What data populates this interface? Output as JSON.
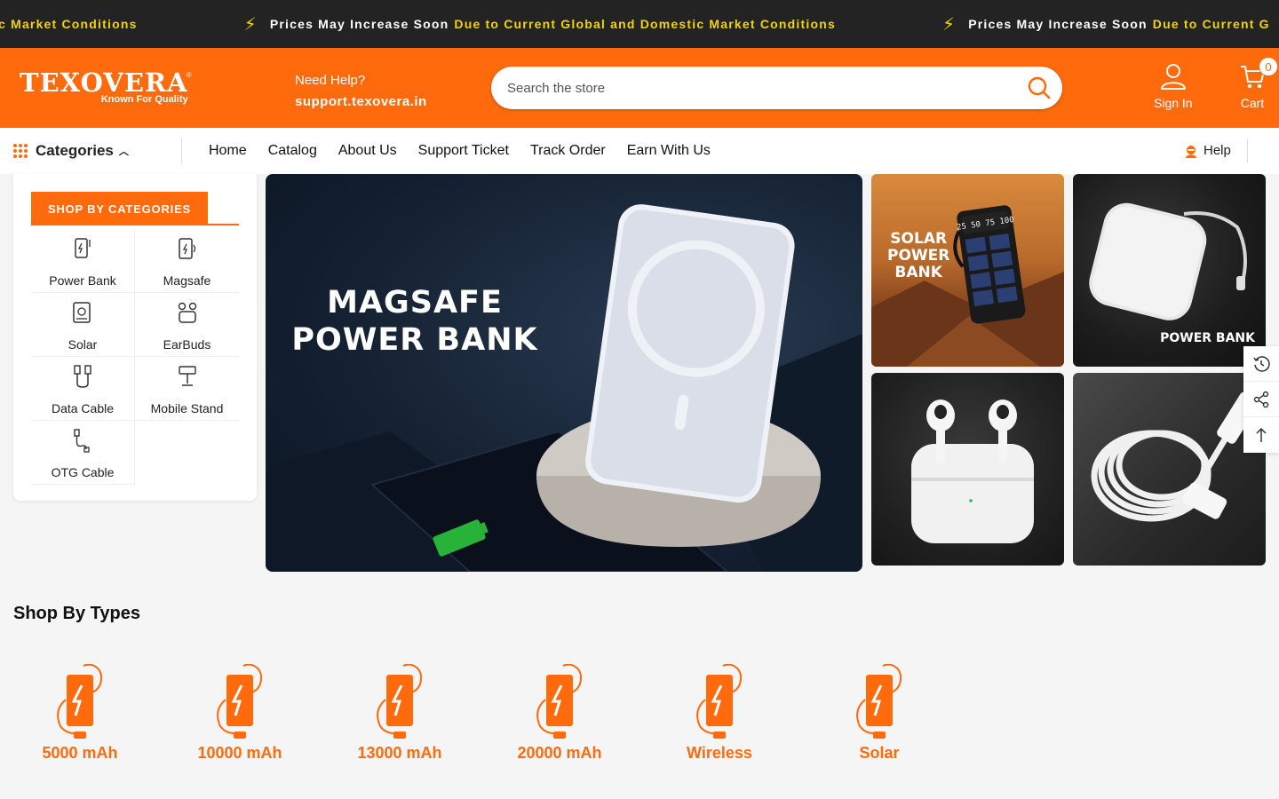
{
  "announcement": {
    "segments": [
      {
        "lead": "",
        "accent": "c Market Conditions"
      },
      {
        "lead": "Prices May Increase Soon",
        "accent": "Due to Current Global and Domestic Market Conditions"
      },
      {
        "lead": "Prices May Increase Soon",
        "accent": "Due to Current G"
      }
    ],
    "icon": "lightning-icon"
  },
  "header": {
    "logo": {
      "name": "TEXOVERA",
      "tagline": "Known For Quality",
      "reg": "®"
    },
    "help": {
      "line1": "Need Help?",
      "line2": "support.texovera.in"
    },
    "search": {
      "placeholder": "Search the store"
    },
    "signin_label": "Sign In",
    "cart_label": "Cart",
    "cart_count": "0"
  },
  "nav": {
    "categories_label": "Categories",
    "links": [
      "Home",
      "Catalog",
      "About Us",
      "Support Ticket",
      "Track Order",
      "Earn With Us"
    ],
    "help_label": "Help"
  },
  "sidebar": {
    "title": "SHOP BY CATEGORIES",
    "items": [
      {
        "label": "Power Bank",
        "icon": "power-bank-icon"
      },
      {
        "label": "Magsafe",
        "icon": "magsafe-icon"
      },
      {
        "label": "Solar",
        "icon": "solar-icon"
      },
      {
        "label": "EarBuds",
        "icon": "earbuds-icon"
      },
      {
        "label": "Data Cable",
        "icon": "data-cable-icon"
      },
      {
        "label": "Mobile Stand",
        "icon": "mobile-stand-icon"
      },
      {
        "label": "OTG Cable",
        "icon": "otg-cable-icon"
      }
    ]
  },
  "hero": {
    "title_line1": "MAGSAFE",
    "title_line2": "POWER BANK"
  },
  "tiles": {
    "solar": {
      "line1": "SOLAR",
      "line2": "POWER",
      "line3": "BANK"
    },
    "powerbank": {
      "label": "POWER BANK"
    }
  },
  "shop_by_types": {
    "title": "Shop By Types",
    "items": [
      "5000 mAh",
      "10000 mAh",
      "13000 mAh",
      "20000 mAh",
      "Wireless",
      "Solar"
    ]
  },
  "colors": {
    "brand": "#ff6a0d",
    "announce_bg": "#232323",
    "announce_accent": "#f4d400"
  }
}
